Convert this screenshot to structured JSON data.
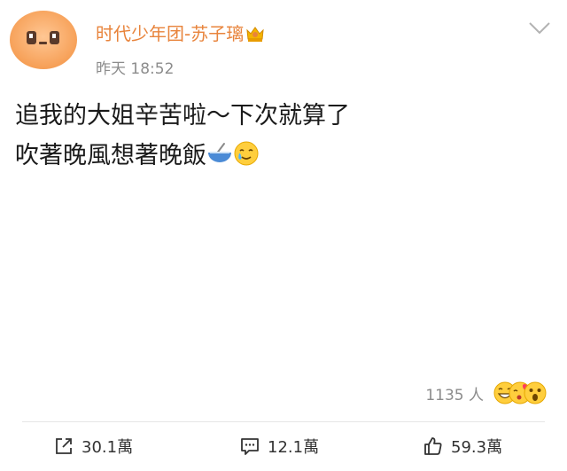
{
  "post": {
    "author": "时代少年团-苏子璃",
    "time": "昨天 18:52",
    "lines": [
      "追我的大姐辛苦啦～下次就算了",
      "吹著晚風想著晚飯"
    ],
    "emoji_icons": [
      "bowl-icon",
      "crying-smile-icon"
    ]
  },
  "reactions": {
    "count": "1135 人",
    "icons": [
      "grin-icon",
      "heart-kiss-icon",
      "surprised-icon"
    ]
  },
  "actions": {
    "repost": "30.1萬",
    "comment": "12.1萬",
    "like": "59.3萬"
  },
  "colors": {
    "username": "#e8843c",
    "meta_text": "#8c8c8c",
    "body_text": "#1a1a1a",
    "avatar": "#f7a15c"
  }
}
